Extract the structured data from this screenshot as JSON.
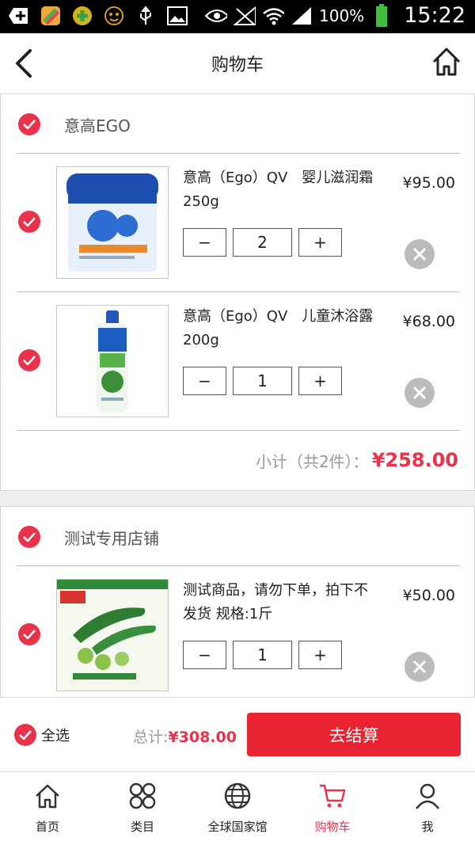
{
  "status_bar": {
    "battery": "100%",
    "time": "15:22"
  },
  "header": {
    "title": "购物车"
  },
  "shops": [
    {
      "name": "意高EGO",
      "items": [
        {
          "name": "意高（Ego）QV　婴儿滋润霜 250g",
          "price": "¥95.00",
          "quantity": "2",
          "minus": "−",
          "plus": "+"
        },
        {
          "name": "意高（Ego）QV　儿童沐浴露 200g",
          "price": "¥68.00",
          "quantity": "1",
          "minus": "−",
          "plus": "+"
        }
      ],
      "subtotal_label": "小计（共2件）：",
      "subtotal_value": "¥258.00"
    },
    {
      "name": "测试专用店铺",
      "items": [
        {
          "name": "测试商品，请勿下单，拍下不发货 规格:1斤",
          "price": "¥50.00",
          "quantity": "1",
          "minus": "−",
          "plus": "+"
        }
      ]
    }
  ],
  "checkout_bar": {
    "select_all": "全选",
    "total_label": "总计:",
    "total_value": "¥308.00",
    "checkout_button": "去结算"
  },
  "tabbar": [
    {
      "label": "首页",
      "icon": "home-icon"
    },
    {
      "label": "类目",
      "icon": "category-icon"
    },
    {
      "label": "全球国家馆",
      "icon": "globe-icon"
    },
    {
      "label": "购物车",
      "icon": "cart-icon",
      "active": true
    },
    {
      "label": "我",
      "icon": "user-icon"
    }
  ],
  "colors": {
    "accent": "#e9334a",
    "button": "#e9232f",
    "remove": "#bbbbbb"
  }
}
